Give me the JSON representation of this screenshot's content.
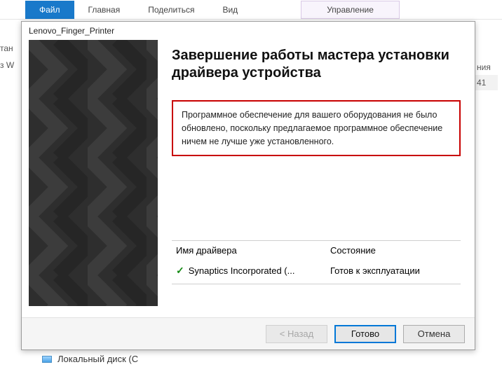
{
  "ribbon": {
    "file": "Файл",
    "home": "Главная",
    "share": "Поделиться",
    "view": "Вид",
    "manage": "Управление"
  },
  "bg": {
    "left1": "тан",
    "left2": "з W",
    "right1": "ния",
    "right2": "41"
  },
  "dialog": {
    "title": "Lenovo_Finger_Printer",
    "heading": "Завершение работы мастера установки драйвера устройства",
    "message": "Программное обеспечение для вашего оборудования не было обновлено, поскольку предлагаемое программное обеспечение ничем не лучше уже установленного.",
    "col_name": "Имя драйвера",
    "col_state": "Состояние",
    "driver_name": "Synaptics Incorporated (...",
    "driver_state": "Готов к эксплуатации",
    "back": "< Назад",
    "finish": "Готово",
    "cancel": "Отмена"
  },
  "footer": {
    "local_disk": "Локальный диск (С"
  }
}
